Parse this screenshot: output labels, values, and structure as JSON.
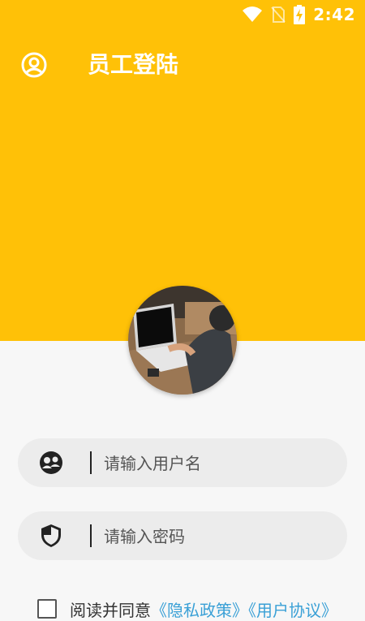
{
  "status_bar": {
    "time": "2:42",
    "icons": [
      "wifi-icon",
      "no-sim-icon",
      "battery-charging-icon"
    ]
  },
  "header": {
    "title": "员工登陆",
    "profile_icon": "account-circle-icon"
  },
  "colors": {
    "primary": "#ffc107",
    "background": "#f7f7f7",
    "input_bg": "#ececec",
    "link": "#3aa0d6"
  },
  "login": {
    "username_placeholder": "请输入用户名",
    "password_placeholder": "请输入密码",
    "username_icon": "user-group-icon",
    "password_icon": "shield-icon"
  },
  "consent": {
    "text": "阅读并同意",
    "privacy_link": "《隐私政策》",
    "user_agreement_link": "《用户协议》"
  }
}
